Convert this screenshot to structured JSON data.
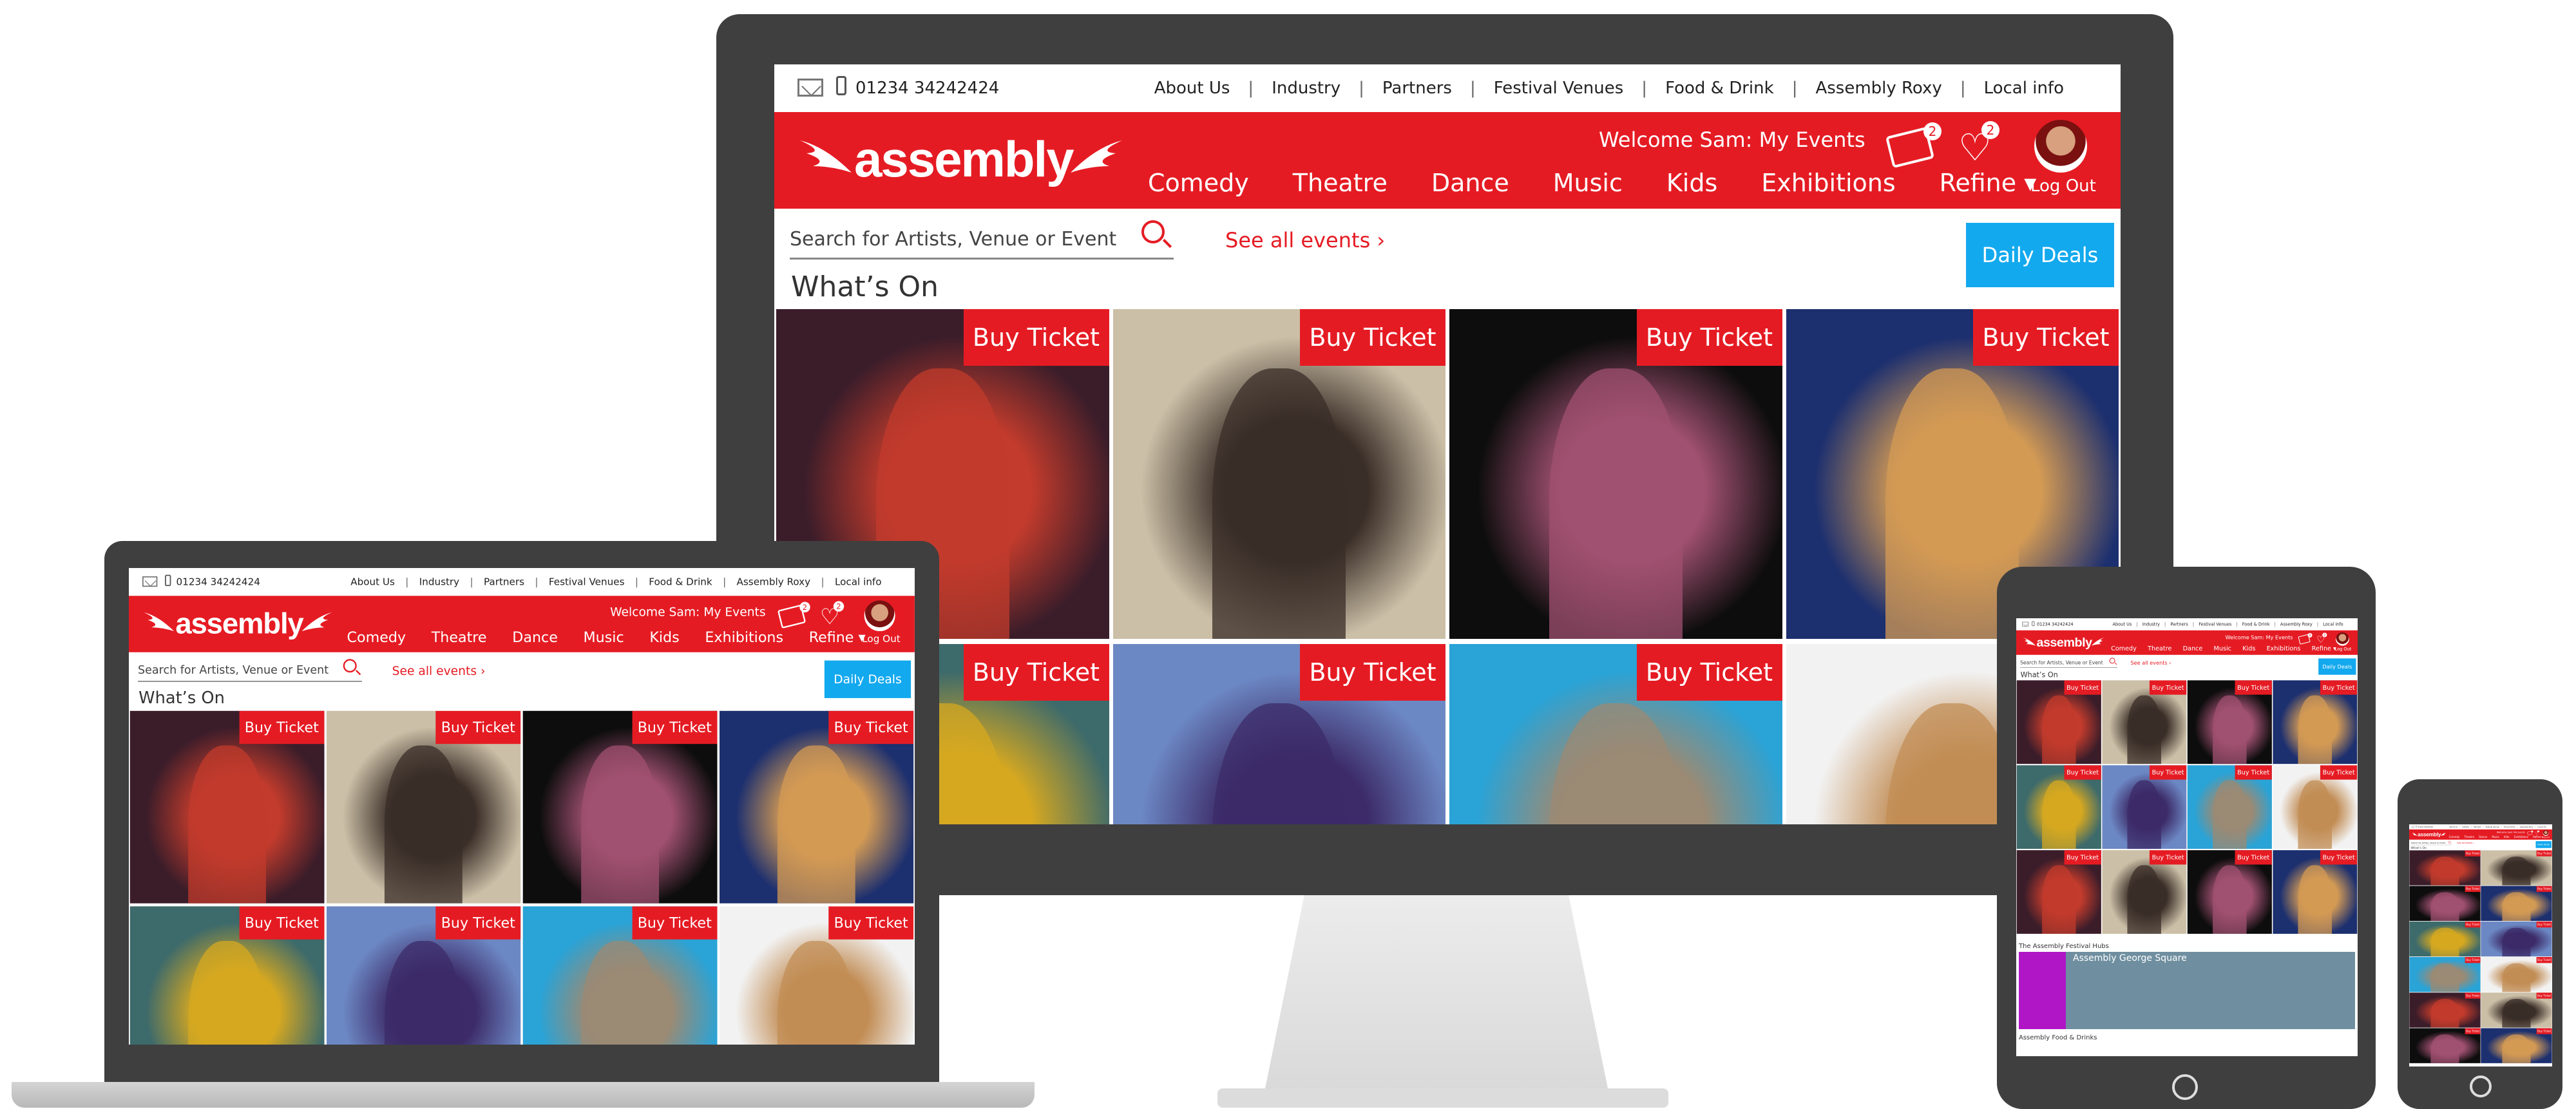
{
  "site": {
    "phone": "01234 34242424",
    "top_links": [
      "About Us",
      "Industry",
      "Partners",
      "Festival Venues",
      "Food & Drink",
      "Assembly Roxy",
      "Local info"
    ],
    "logo_text": "assembly",
    "welcome": "Welcome Sam: My Events",
    "tickets_count": "2",
    "favourites_count": "2",
    "nav": [
      "Comedy",
      "Theatre",
      "Dance",
      "Music",
      "Kids",
      "Exhibitions",
      "Refine ▾"
    ],
    "logout": "Log Out",
    "search_placeholder": "Search for Artists, Venue or Event",
    "see_all": "See all events ›",
    "daily_deals": "Daily Deals",
    "whats_on": "What’s On",
    "buy_ticket": "Buy Ticket"
  },
  "tiles": [
    {
      "desc": "singer-red-dress",
      "bg": "#3b1d2a",
      "accent": "#c23b2c"
    },
    {
      "desc": "woman-sepia",
      "bg": "#cbbfa7",
      "accent": "#3a2e28"
    },
    {
      "desc": "puppet-woman",
      "bg": "#0d0d0d",
      "accent": "#a05070"
    },
    {
      "desc": "man-blue-curtain",
      "bg": "#1c2f6f",
      "accent": "#d39a54"
    },
    {
      "desc": "gold-dancer",
      "bg": "#3d6a6b",
      "accent": "#d6a820"
    },
    {
      "desc": "woman-blue-tone",
      "bg": "#6c88c4",
      "accent": "#3c2b68"
    },
    {
      "desc": "glasses-puppet",
      "bg": "#2aa3d6",
      "accent": "#9b8a74"
    },
    {
      "desc": "curly-man",
      "bg": "#f2f2f2",
      "accent": "#c28d55"
    }
  ],
  "tablet": {
    "section_venues": "The Assembly Festival Hubs",
    "venue_title": "Assembly George Square",
    "section_food": "Assembly Food & Drinks"
  }
}
